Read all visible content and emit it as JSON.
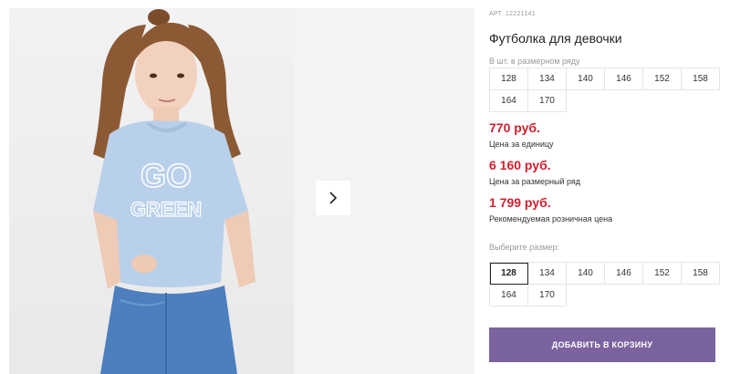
{
  "product": {
    "article": "АРТ. 12221141",
    "title": "Футболка для девочки"
  },
  "size_row": {
    "label": "В шт. в размерном ряду",
    "sizes": [
      "128",
      "134",
      "140",
      "146",
      "152",
      "158",
      "164",
      "170"
    ]
  },
  "prices": [
    {
      "value": "770 руб.",
      "label": "Цена за единицу"
    },
    {
      "value": "6 160 руб.",
      "label": "Цена за размерный ряд"
    },
    {
      "value": "1 799 руб.",
      "label": "Рекомендуемая розничная цена"
    }
  ],
  "size_select": {
    "label": "Выберите размер:",
    "selected": "128",
    "sizes": [
      "128",
      "134",
      "140",
      "146",
      "152",
      "158",
      "164",
      "170"
    ]
  },
  "cart": {
    "button_label": "ДОБАВИТЬ В КОРЗИНУ"
  },
  "gallery": {
    "next_icon": "chevron-right-icon",
    "shirt_print_line1": "GO",
    "shirt_print_line2": "GREEN"
  },
  "colors": {
    "price": "#d1202f",
    "button": "#7b63a0",
    "shirt": "#b9d0ea",
    "jeans": "#4d7fbf"
  }
}
